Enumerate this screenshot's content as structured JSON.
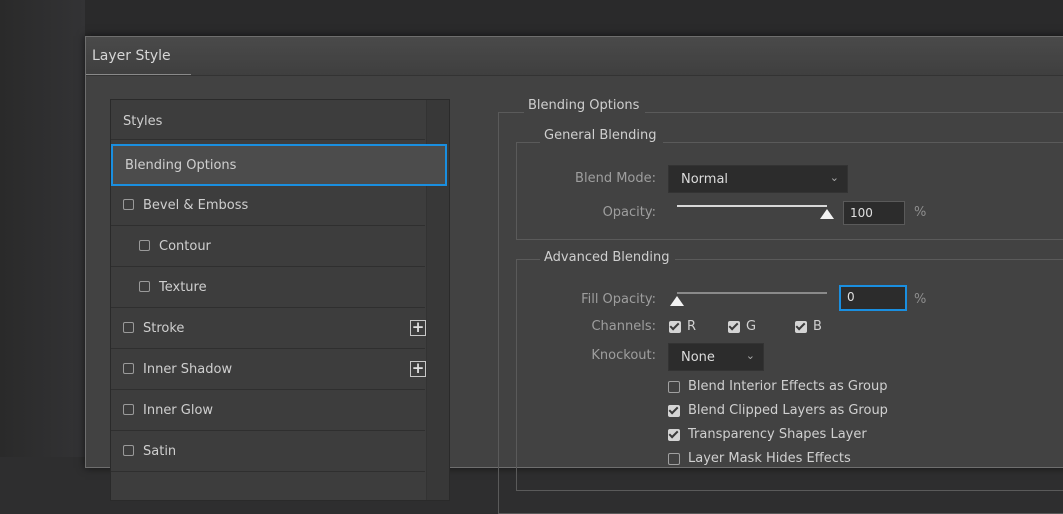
{
  "dialog": {
    "title": "Layer Style"
  },
  "styles_panel": {
    "header": "Styles",
    "items": [
      {
        "label": "Blending Options",
        "selected": true,
        "has_checkbox": false,
        "checked": false,
        "has_plus": false,
        "indent": 0
      },
      {
        "label": "Bevel & Emboss",
        "selected": false,
        "has_checkbox": true,
        "checked": false,
        "has_plus": false,
        "indent": 0
      },
      {
        "label": "Contour",
        "selected": false,
        "has_checkbox": true,
        "checked": false,
        "has_plus": false,
        "indent": 1
      },
      {
        "label": "Texture",
        "selected": false,
        "has_checkbox": true,
        "checked": false,
        "has_plus": false,
        "indent": 1
      },
      {
        "label": "Stroke",
        "selected": false,
        "has_checkbox": true,
        "checked": false,
        "has_plus": true,
        "indent": 0
      },
      {
        "label": "Inner Shadow",
        "selected": false,
        "has_checkbox": true,
        "checked": false,
        "has_plus": true,
        "indent": 0
      },
      {
        "label": "Inner Glow",
        "selected": false,
        "has_checkbox": true,
        "checked": false,
        "has_plus": false,
        "indent": 0
      },
      {
        "label": "Satin",
        "selected": false,
        "has_checkbox": true,
        "checked": false,
        "has_plus": false,
        "indent": 0
      }
    ],
    "plus_glyph": "+"
  },
  "blending_options": {
    "section_title": "Blending Options",
    "general": {
      "title": "General Blending",
      "blend_mode_label": "Blend Mode:",
      "blend_mode_value": "Normal",
      "opacity_label": "Opacity:",
      "opacity_value": "100",
      "opacity_fraction": 1.0,
      "percent": "%"
    },
    "advanced": {
      "title": "Advanced Blending",
      "fill_opacity_label": "Fill Opacity:",
      "fill_opacity_value": "0",
      "fill_opacity_fraction": 0.0,
      "percent": "%",
      "channels_label": "Channels:",
      "channels": [
        {
          "label": "R",
          "checked": true
        },
        {
          "label": "G",
          "checked": true
        },
        {
          "label": "B",
          "checked": true
        }
      ],
      "knockout_label": "Knockout:",
      "knockout_value": "None",
      "options": [
        {
          "label": "Blend Interior Effects as Group",
          "checked": false
        },
        {
          "label": "Blend Clipped Layers as Group",
          "checked": true
        },
        {
          "label": "Transparency Shapes Layer",
          "checked": true
        },
        {
          "label": "Layer Mask Hides Effects",
          "checked": false
        }
      ]
    }
  },
  "colors": {
    "focus_accent": "#1a8fe0",
    "dialog_bg": "#424242",
    "field_bg": "#2c2c2c"
  },
  "icons": {
    "dropdown": "chevron-down-icon",
    "add": "plus-icon"
  }
}
